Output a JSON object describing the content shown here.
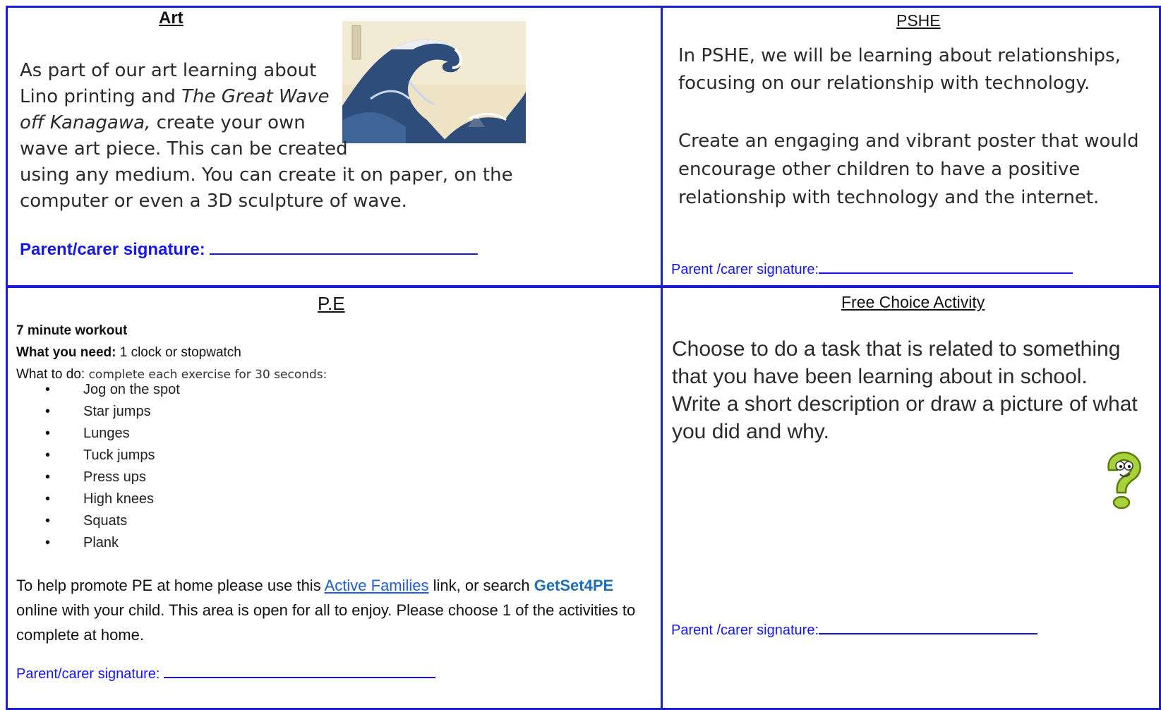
{
  "art": {
    "title": "Art",
    "text_line1": "As part of our art learning about",
    "text_line2": "Lino printing and ",
    "text_line2_italic": "The Great Wave",
    "text_line3_italic": "off Kanagawa,",
    "text_line3": " create your own",
    "text_line4": "wave art piece. This can be created",
    "text_line5": "using any medium. You can create it on paper, on the",
    "text_line6": "computer or even a 3D sculpture of wave.",
    "signature_label": "Parent/carer signature: "
  },
  "pshe": {
    "title": "PSHE",
    "para1": "In PSHE, we will be learning about relationships, focusing on our relationship with technology.",
    "para2": "Create an engaging and vibrant poster that would encourage other children to have a positive relationship with technology and the internet.",
    "signature_label": "Parent /carer signature:"
  },
  "pe": {
    "title": "P.E",
    "workout_title": "7 minute workout",
    "need_label": "What you need:",
    "need_value": " 1 clock or stopwatch",
    "todo_label": "What to do:",
    "todo_value": " complete each exercise for 30 seconds:",
    "exercises": [
      "Jog on the spot",
      "Star jumps",
      "Lunges",
      "Tuck jumps",
      "Press ups",
      "High knees",
      "Squats",
      "Plank"
    ],
    "help_text1": "To help promote PE at home please use this ",
    "help_link": "Active Families",
    "help_text2": " link, or search ",
    "help_brand": "GetSet4PE",
    "help_text3": " online with your child. This area is open for all to enjoy. Please choose 1 of the activities to complete at home.",
    "signature_label": "Parent/carer signature: "
  },
  "free_choice": {
    "title": "Free Choice Activity",
    "text1": "Choose to do a task that is related to something that you have been learning about in school.",
    "text2": "Write a short description or draw a picture of what you did and why.",
    "signature_label": "Parent /carer signature:"
  },
  "colors": {
    "border": "#1c1cd0",
    "signature": "#1616e6",
    "link": "#1f5fd6",
    "question_mark": "#a8d23a"
  },
  "icons": {
    "art_image": "great-wave-image",
    "free_choice_image": "question-mark-icon"
  }
}
